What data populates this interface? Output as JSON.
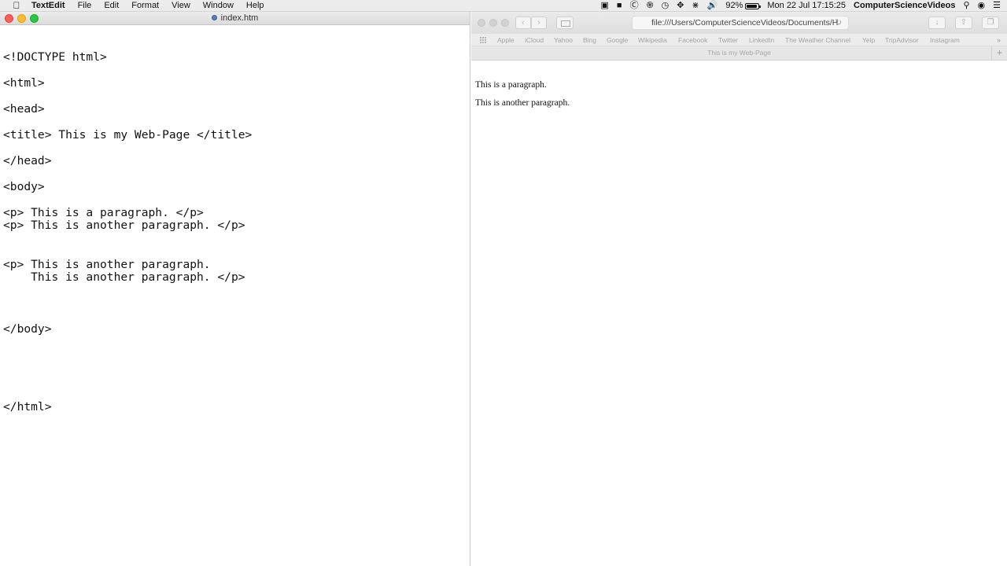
{
  "menubar": {
    "app_name": "TextEdit",
    "items": [
      "File",
      "Edit",
      "Format",
      "View",
      "Window",
      "Help"
    ],
    "battery_percent": "92%",
    "battery_level": 0.92,
    "datetime": "Mon 22 Jul  17:15:25",
    "user": "ComputerScienceVideos"
  },
  "textedit": {
    "title": "index.htm",
    "lines": [
      "<!DOCTYPE html>",
      "<html>",
      "<head>",
      "<title> This is my Web-Page </title>",
      "</head>",
      "<body>",
      "<p> This is a paragraph. </p>",
      "<p> This is another paragraph. </p>",
      "<p> This is another paragraph.",
      "    This is another paragraph. </p>",
      "</body>",
      "</html>"
    ]
  },
  "safari": {
    "url": "file:///Users/ComputerScienceVideos/Documents/H",
    "favorites": [
      "Apple",
      "iCloud",
      "Yahoo",
      "Bing",
      "Google",
      "Wikipedia",
      "Facebook",
      "Twitter",
      "LinkedIn",
      "The Weather Channel",
      "Yelp",
      "TripAdvisor",
      "Instagram"
    ],
    "tab_title": "This is my Web-Page",
    "page_paragraphs": [
      "This is a paragraph.",
      "This is another paragraph."
    ]
  }
}
